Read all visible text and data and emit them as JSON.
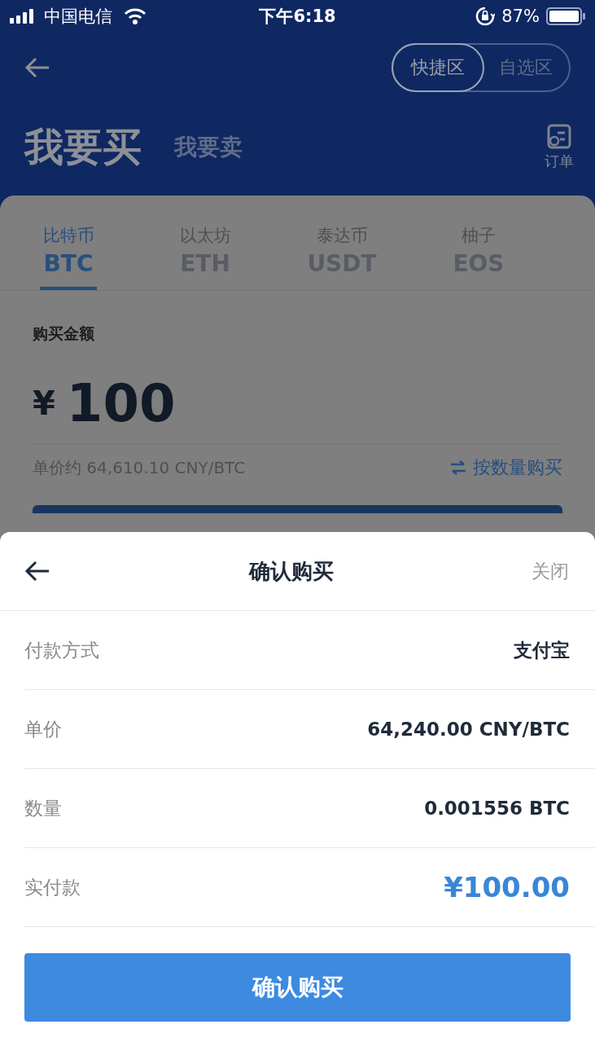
{
  "status_bar": {
    "carrier": "中国电信",
    "time": "下午6:18",
    "battery": "87%"
  },
  "header": {
    "zones": [
      {
        "label": "快捷区",
        "selected": true
      },
      {
        "label": "自选区",
        "selected": false
      }
    ],
    "modes": [
      {
        "label": "我要买",
        "selected": true
      },
      {
        "label": "我要卖",
        "selected": false
      }
    ],
    "orders_label": "订单"
  },
  "coins": [
    {
      "name": "比特币",
      "symbol": "BTC",
      "selected": true
    },
    {
      "name": "以太坊",
      "symbol": "ETH",
      "selected": false
    },
    {
      "name": "泰达币",
      "symbol": "USDT",
      "selected": false
    },
    {
      "name": "柚子",
      "symbol": "EOS",
      "selected": false
    }
  ],
  "amount": {
    "label": "购买金额",
    "currency": "¥",
    "value": "100",
    "unit_price": "单价约 64,610.10 CNY/BTC",
    "switch_label": "按数量购买"
  },
  "sheet": {
    "title": "确认购买",
    "close": "关闭",
    "rows": [
      {
        "label": "付款方式",
        "value": "支付宝",
        "kind": "plain"
      },
      {
        "label": "单价",
        "value": "64,240.00 CNY/BTC",
        "kind": "plain"
      },
      {
        "label": "数量",
        "value": "0.001556 BTC",
        "kind": "plain"
      },
      {
        "label": "实付款",
        "value": "¥100.00",
        "kind": "total"
      }
    ],
    "confirm": "确认购买"
  }
}
